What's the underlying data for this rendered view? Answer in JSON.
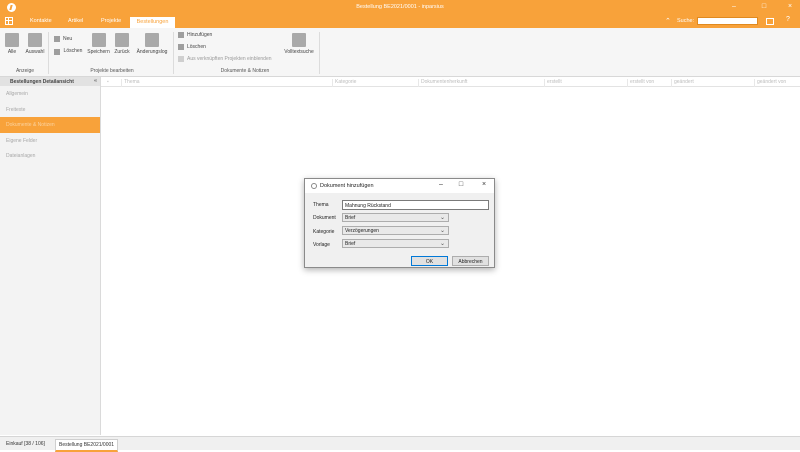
{
  "window": {
    "title": "Bestellung BE2021/0001 - inparsius",
    "controls": {
      "minimize": "–",
      "maximize": "□",
      "close": "×"
    }
  },
  "menu": {
    "tabs": [
      "Kontakte",
      "Artikel",
      "Projekte",
      "Bestellungen"
    ],
    "active_tab": "Bestellungen",
    "search_label": "Suche:",
    "search_value": "",
    "icons": [
      "chevron-up-icon",
      "printer-icon",
      "help-icon"
    ],
    "right_glyphs": {
      "chevron": "⌃",
      "help": "?"
    }
  },
  "ribbon": {
    "groups": {
      "anzeige": {
        "label": "Anzeige",
        "buttons": [
          "Alle",
          "Auswahl"
        ]
      },
      "projekte": {
        "label": "Projekte bearbeiten",
        "small_buttons": [
          "Neu",
          "Löschen"
        ],
        "buttons": [
          "Speichern",
          "Zurück",
          "Änderungslog"
        ]
      },
      "dokumente": {
        "label": "Dokumente & Notizen",
        "small_buttons": [
          "Hinzufügen",
          "Löschen",
          "Aus verknüpften Projekten einblenden"
        ],
        "buttons": [
          "Volltextsuche"
        ]
      }
    }
  },
  "sidebar": {
    "header": "Bestellungen Detailansicht",
    "collapse_glyph": "«",
    "items": [
      "Allgemein",
      "Freitexte",
      "Dokumente & Notizen",
      "Eigene Felder",
      "Dateianlagen"
    ],
    "active_index": 2
  },
  "grid": {
    "columns": [
      "Thema",
      "Kategorie",
      "Dokumentenherkunft",
      "erstellt",
      "erstellt von",
      "geändert",
      "geändert von"
    ]
  },
  "statusbar": {
    "tabs": [
      "Einkauf [38 / 106]",
      "Bestellung BE2021/0001"
    ],
    "active_index": 1
  },
  "dialog": {
    "title": "Dokument hinzufügen",
    "controls": {
      "minimize": "–",
      "maximize": "□",
      "close": "×"
    },
    "fields": {
      "thema": {
        "label": "Thema",
        "value": "Mahnung Rückstand"
      },
      "dokument": {
        "label": "Dokument",
        "value": "Brief"
      },
      "kategorie": {
        "label": "Kategorie",
        "value": "Verzögerungen"
      },
      "vorlage": {
        "label": "Vorlage",
        "value": "Brief"
      }
    },
    "caret": "⌄",
    "ok_label": "OK",
    "cancel_label": "Abbrechen"
  },
  "colors": {
    "accent": "#f8a23a",
    "sidebar_bg": "#f3f3f3",
    "ribbon_bg": "#f6f6f6",
    "dialog_bg": "#f0f0f0"
  }
}
